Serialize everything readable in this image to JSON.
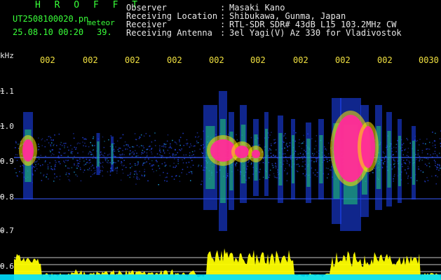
{
  "header": {
    "app_name": "H R O F F T",
    "filename": "UT2508100020.pn",
    "tag": "meteor",
    "datetime": "25.08.10 00:20",
    "count": "39."
  },
  "meta": [
    {
      "label": "Observer",
      "value": "Masaki Kano"
    },
    {
      "label": "Receiving Location",
      "value": "Shibukawa, Gunma, Japan"
    },
    {
      "label": "Receiver",
      "value": "RTL-SDR SDR# 43dB L15 103.2MHz CW"
    },
    {
      "label": "Receiving Antenna",
      "value": "3el Yagi(V) Az 330 for Vladivostok"
    }
  ],
  "meta_colon": ":",
  "axis": {
    "unit": "kHz",
    "freq_labels": [
      "1.1",
      "1.0",
      "0.9",
      "0.8",
      "0.7",
      "0.6"
    ],
    "time_labels": [
      "002",
      "002",
      "002",
      "002",
      "002",
      "002",
      "002",
      "002",
      "002",
      "0030"
    ]
  },
  "colors": {
    "background": "#000000",
    "header_green": "#39ff39",
    "time_label_yellow": "#f0e040",
    "echo_magenta": "#ff2a9a",
    "noise_blue": "#2a4cff",
    "level_yellow": "#ffff00",
    "baseline_cyan": "#00e0ff"
  }
}
